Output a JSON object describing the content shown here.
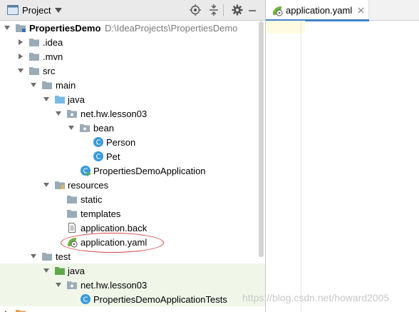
{
  "panel": {
    "title": "Project"
  },
  "tree": {
    "project": {
      "name": "PropertiesDemo",
      "path": "D:\\IdeaProjects\\PropertiesDemo"
    },
    "idea": ".idea",
    "mvn": ".mvn",
    "src": "src",
    "main": "main",
    "main_java": "java",
    "main_pkg": "net.hw.lesson03",
    "bean": "bean",
    "person": "Person",
    "pet": "Pet",
    "app_class": "PropertiesDemoApplication",
    "resources": "resources",
    "static": "static",
    "templates": "templates",
    "app_back": "application.back",
    "app_yaml": "application.yaml",
    "test": "test",
    "test_java": "java",
    "test_pkg": "net.hw.lesson03",
    "test_class": "PropertiesDemoApplicationTests"
  },
  "editor": {
    "tab_label": "application.yaml"
  },
  "watermark": "https://blog.csdn.net/howard2005",
  "colors": {
    "folder": "#9aabb8",
    "source_folder": "#79b9e5",
    "test_folder": "#5fa94c",
    "class": "#3a9ad9",
    "annotation": "#d94040"
  }
}
